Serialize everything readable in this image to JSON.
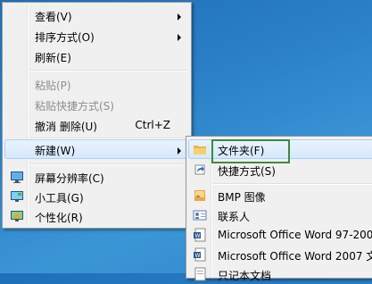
{
  "context_menu": {
    "items": [
      {
        "label": "查看(V)",
        "has_submenu": true
      },
      {
        "label": "排序方式(O)",
        "has_submenu": true
      },
      {
        "label": "刷新(E)"
      },
      {
        "label": "粘贴(P)",
        "disabled": true
      },
      {
        "label": "粘贴快捷方式(S)",
        "disabled": true
      },
      {
        "label": "撤消 删除(U)",
        "shortcut": "Ctrl+Z"
      },
      {
        "label": "新建(W)",
        "has_submenu": true,
        "highlighted": true
      },
      {
        "label": "屏幕分辨率(C)",
        "icon": "display-icon"
      },
      {
        "label": "小工具(G)",
        "icon": "gadgets-icon"
      },
      {
        "label": "个性化(R)",
        "icon": "personalize-icon"
      }
    ]
  },
  "new_submenu": {
    "items": [
      {
        "label": "文件夹(F)",
        "icon": "folder-icon",
        "highlighted": true
      },
      {
        "label": "快捷方式(S)",
        "icon": "shortcut-icon"
      },
      {
        "label": "BMP 图像",
        "icon": "bmp-icon"
      },
      {
        "label": "联系人",
        "icon": "contact-icon"
      },
      {
        "label": "Microsoft Office Word 97-200",
        "icon": "word-doc-icon"
      },
      {
        "label": "Microsoft Office Word 2007 文",
        "icon": "word-docx-icon"
      },
      {
        "label": "只记本文档",
        "icon": "text-doc-icon"
      }
    ]
  },
  "colors": {
    "desktop": "#2a7fc7",
    "menu_bg": "#f0f0f0",
    "highlight_border": "#aecff7",
    "focus_outline": "#3c8a3a"
  }
}
